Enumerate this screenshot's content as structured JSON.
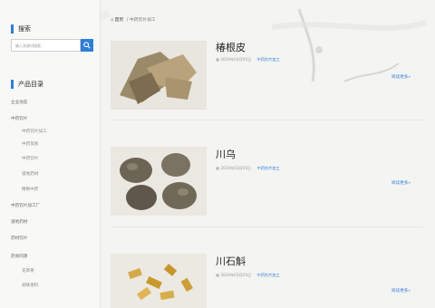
{
  "sidebar": {
    "search_title": "搜索",
    "search_placeholder": "输入关键词搜索...",
    "products_title": "产品目录",
    "items": [
      {
        "label": "企业动态",
        "sub": false
      },
      {
        "label": "中药饮片",
        "sub": false
      },
      {
        "label": "中药饮片加工",
        "sub": true
      },
      {
        "label": "中药贸易",
        "sub": true
      },
      {
        "label": "中药饮片",
        "sub": true
      },
      {
        "label": "道地药材",
        "sub": true
      },
      {
        "label": "精制中药",
        "sub": true
      },
      {
        "label": "中药饮片加工厂",
        "sub": false
      },
      {
        "label": "道地药材",
        "sub": false
      },
      {
        "label": "药材饮片",
        "sub": false
      },
      {
        "label": "药食同源",
        "sub": false
      },
      {
        "label": "花草茶",
        "sub": true
      },
      {
        "label": "调味香料",
        "sub": true
      }
    ]
  },
  "breadcrumb": {
    "home": "首页",
    "sep": "/",
    "current": "中药饮片加工"
  },
  "cards": [
    {
      "title": "椿根皮",
      "date": "2019年03月05日",
      "category": "中药饮片加工",
      "more": "阅读更多»"
    },
    {
      "title": "川乌",
      "date": "2019年03月05日",
      "category": "中药饮片加工",
      "more": "阅读更多»"
    },
    {
      "title": "川石斛",
      "date": "2019年03月05日",
      "category": "中药饮片加工",
      "more": "阅读更多»"
    }
  ],
  "colors": {
    "accent": "#2f7ed8"
  }
}
